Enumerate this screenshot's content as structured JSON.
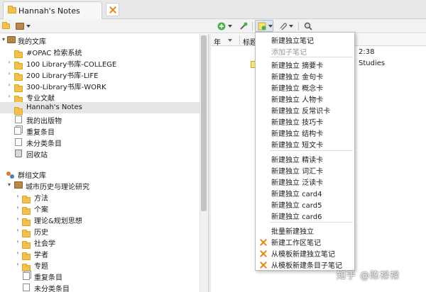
{
  "tab": {
    "title": "Hannah's Notes"
  },
  "toolbar": {
    "icons": [
      "new-collection-icon",
      "library-menu-icon",
      "new-item-icon",
      "add-by-identifier-icon",
      "new-note-icon",
      "attachment-icon",
      "search-icon"
    ]
  },
  "tree": {
    "my_library": "我的文库",
    "collections": [
      "#OPAC 检索系统",
      "100 Library书库-COLLEGE",
      "200 Library书库-LIFE",
      "300-Library书库-WORK",
      "专业文献",
      "Hannah's Notes"
    ],
    "my_publications": "我的出版物",
    "duplicates": "重复条目",
    "unfiled": "未分类条目",
    "trash": "回收站",
    "group_libraries": "群组文库",
    "group_name": "城市历史与理论研究",
    "group_children": [
      "方法",
      "个案",
      "理论&规划思想",
      "历史",
      "社会学",
      "学者",
      "专题"
    ],
    "group_duplicates": "重复条目",
    "group_unfiled": "未分类条目"
  },
  "columns": {
    "year": "年",
    "title": "标题"
  },
  "items": {
    "time_fragment": "2:38",
    "title_fragment": "Studies"
  },
  "menu": {
    "items": [
      {
        "label": "新建独立笔记",
        "enabled": true
      },
      {
        "label": "添加子笔记",
        "enabled": false
      },
      {
        "label": "新建独立 摘要卡",
        "enabled": true
      },
      {
        "label": "新建独立 金句卡",
        "enabled": true
      },
      {
        "label": "新建独立 概念卡",
        "enabled": true
      },
      {
        "label": "新建独立 人物卡",
        "enabled": true
      },
      {
        "label": "新建独立 反常识卡",
        "enabled": true
      },
      {
        "label": "新建独立 技巧卡",
        "enabled": true
      },
      {
        "label": "新建独立 结构卡",
        "enabled": true
      },
      {
        "label": "新建独立 短文卡",
        "enabled": true
      },
      {
        "label": "新建独立 精读卡",
        "enabled": true
      },
      {
        "label": "新建独立 词汇卡",
        "enabled": true
      },
      {
        "label": "新建独立 泛读卡",
        "enabled": true
      },
      {
        "label": "新建独立 card4",
        "enabled": true
      },
      {
        "label": "新建独立 card5",
        "enabled": true
      },
      {
        "label": "新建独立 card6",
        "enabled": true
      },
      {
        "label": "批量新建独立",
        "enabled": true
      },
      {
        "label": "新建工作区笔记",
        "enabled": true
      },
      {
        "label": "从模板新建独立笔记",
        "enabled": true
      },
      {
        "label": "从模板新建条目子笔记",
        "enabled": true
      }
    ]
  },
  "watermark": "知乎 @陈禄禄"
}
